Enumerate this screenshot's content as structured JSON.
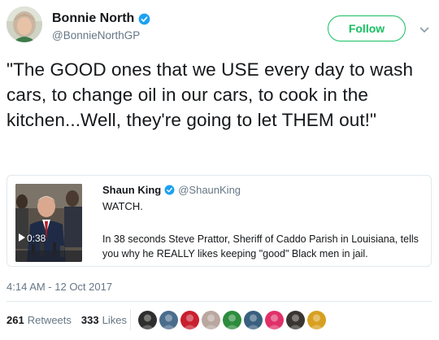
{
  "author": {
    "display_name": "Bonnie North",
    "handle": "@BonnieNorthGP",
    "verified": true,
    "avatar_icon": "profile-photo"
  },
  "follow_button": {
    "label": "Follow",
    "color": "#17bf63"
  },
  "tweet": {
    "text": "\"The GOOD ones that we USE every day to wash cars, to change oil in our cars, to cook in the kitchen...Well, they're going to let THEM out!\"",
    "timestamp": "4:14 AM - 12 Oct 2017"
  },
  "quoted_tweet": {
    "display_name": "Shaun King",
    "handle": "@ShaunKing",
    "verified": true,
    "first_line": "WATCH.",
    "body": "In 38 seconds Steve Prattor, Sheriff of Caddo Parish in Louisiana, tells you why he REALLY likes keeping \"good\" Black men in jail.",
    "video_duration": "0:38"
  },
  "stats": {
    "retweets_count": "261",
    "retweets_label": "Retweets",
    "likes_count": "333",
    "likes_label": "Likes"
  },
  "likers": [
    {
      "icon": "liker-avatar-1",
      "color": "#2e2e2e"
    },
    {
      "icon": "liker-avatar-2",
      "color": "#4a6d8c"
    },
    {
      "icon": "liker-avatar-3",
      "color": "#c8202f"
    },
    {
      "icon": "liker-avatar-4",
      "color": "#b9a7a0"
    },
    {
      "icon": "liker-avatar-5",
      "color": "#2c8c3c"
    },
    {
      "icon": "liker-avatar-6",
      "color": "#39607f"
    },
    {
      "icon": "liker-avatar-7",
      "color": "#e0306a"
    },
    {
      "icon": "liker-avatar-8",
      "color": "#3a3530"
    },
    {
      "icon": "liker-avatar-9",
      "color": "#d8a020"
    }
  ],
  "colors": {
    "text_primary": "#14171a",
    "text_secondary": "#657786",
    "border": "#e1e8ed",
    "verified_blue": "#1da1f2"
  }
}
